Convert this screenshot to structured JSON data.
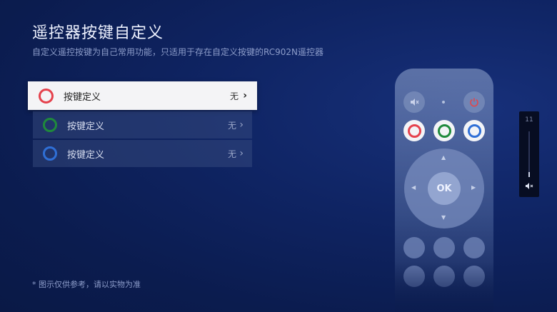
{
  "header": {
    "title": "遥控器按键自定义",
    "subtitle": "自定义遥控按键为自己常用功能，只适用于存在自定义按键的RC902N遥控器"
  },
  "key_list": [
    {
      "label": "按键定义",
      "value": "无",
      "color": "#e5424d",
      "chevron": "›"
    },
    {
      "label": "按键定义",
      "value": "无",
      "color": "#1f8a3c",
      "chevron": "›"
    },
    {
      "label": "按键定义",
      "value": "无",
      "color": "#2f6fd6",
      "chevron": "›"
    }
  ],
  "footnote": "* 图示仅供参考，请以实物为准",
  "remote": {
    "ok_label": "OK",
    "mute_icon": "speaker-muted-icon",
    "power_icon": "power-icon",
    "color_buttons": [
      "#e5424d",
      "#1f8a3c",
      "#2f6fd6"
    ]
  },
  "volume": {
    "level": "11",
    "level_fraction": 0.11,
    "icon": "volume-muted-icon"
  }
}
